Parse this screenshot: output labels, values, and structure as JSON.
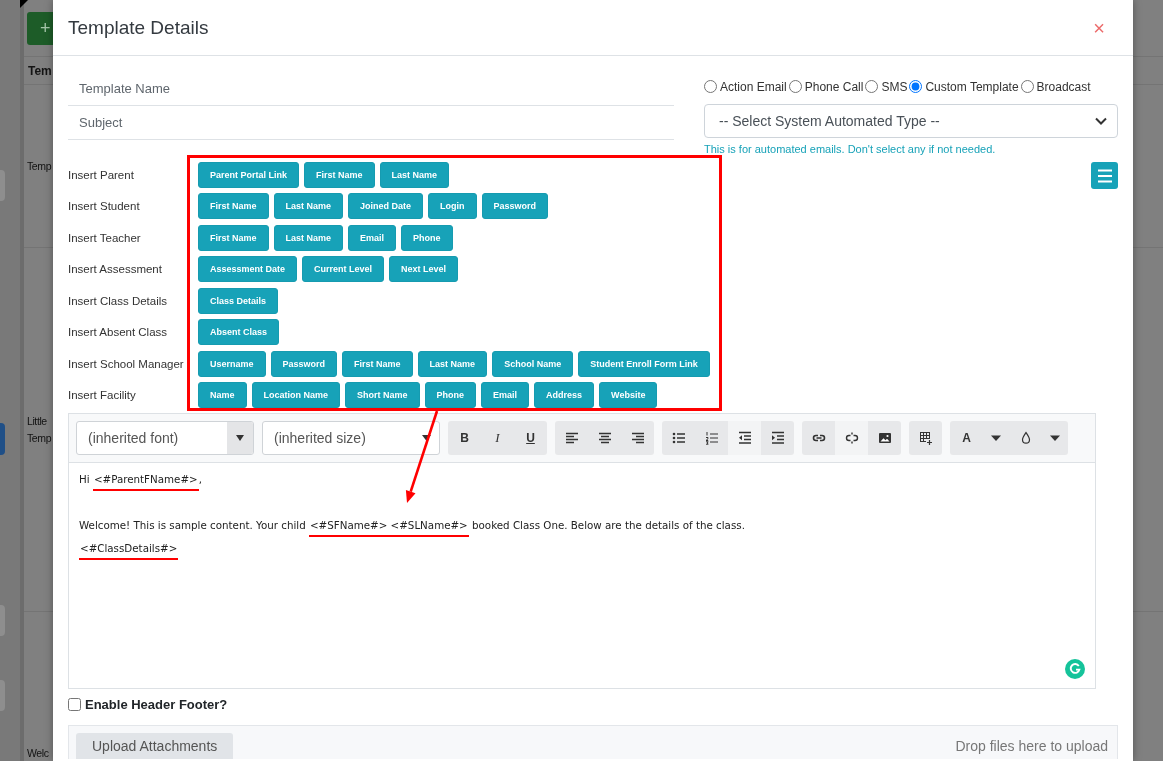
{
  "background_page": {
    "add_button": "+",
    "column_header": "Tem",
    "rows": [
      [
        "Temp"
      ],
      [
        "Little",
        "Temp"
      ],
      [
        "Welc"
      ]
    ],
    "side_buttons": [
      {
        "selected": false
      },
      {
        "selected": true
      },
      {
        "selected": false
      },
      {
        "selected": false
      }
    ]
  },
  "modal": {
    "title": "Template Details",
    "close": "×"
  },
  "form": {
    "template_name": {
      "placeholder": "Template Name"
    },
    "subject": {
      "placeholder": "Subject"
    },
    "template_types": [
      {
        "label": "Action Email",
        "selected": false
      },
      {
        "label": "Phone Call",
        "selected": false
      },
      {
        "label": "SMS",
        "selected": false
      },
      {
        "label": "Custom Template",
        "selected": true
      },
      {
        "label": "Broadcast",
        "selected": false
      }
    ],
    "system_type": {
      "value": "-- Select System Automated Type --"
    },
    "help_text": "This is for automated emails. Don't select any if not needed."
  },
  "insert_groups": [
    {
      "label": "Insert Parent",
      "buttons": [
        "Parent Portal Link",
        "First Name",
        "Last Name"
      ]
    },
    {
      "label": "Insert Student",
      "buttons": [
        "First Name",
        "Last Name",
        "Joined Date",
        "Login",
        "Password"
      ]
    },
    {
      "label": "Insert Teacher",
      "buttons": [
        "First Name",
        "Last Name",
        "Email",
        "Phone"
      ]
    },
    {
      "label": "Insert Assessment",
      "buttons": [
        "Assessment Date",
        "Current Level",
        "Next Level"
      ]
    },
    {
      "label": "Insert Class Details",
      "buttons": [
        "Class Details"
      ]
    },
    {
      "label": "Insert Absent Class",
      "buttons": [
        "Absent Class"
      ]
    },
    {
      "label": "Insert School Manager",
      "buttons": [
        "Username",
        "Password",
        "First Name",
        "Last Name",
        "School Name",
        "Student Enroll Form Link"
      ]
    },
    {
      "label": "Insert Facility",
      "buttons": [
        "Name",
        "Location Name",
        "Short Name",
        "Phone",
        "Email",
        "Address",
        "Website"
      ]
    }
  ],
  "editor": {
    "font": "(inherited font)",
    "size": "(inherited size)",
    "toolbar_groups": [
      {
        "buttons": [
          {
            "kind": "bold",
            "label": "B",
            "disabled": false
          },
          {
            "kind": "italic",
            "label": "I",
            "disabled": false
          },
          {
            "kind": "underline",
            "label": "U",
            "disabled": false
          }
        ]
      },
      {
        "buttons": [
          {
            "kind": "align-left",
            "disabled": false
          },
          {
            "kind": "align-center",
            "disabled": false
          },
          {
            "kind": "align-right",
            "disabled": false
          }
        ]
      },
      {
        "buttons": [
          {
            "kind": "bullet-list",
            "disabled": false
          },
          {
            "kind": "numbered-list",
            "disabled": false
          },
          {
            "kind": "outdent",
            "disabled": true
          },
          {
            "kind": "indent",
            "disabled": false
          }
        ]
      },
      {
        "buttons": [
          {
            "kind": "link",
            "disabled": false
          },
          {
            "kind": "unlink",
            "disabled": true
          },
          {
            "kind": "image",
            "disabled": false
          }
        ]
      },
      {
        "buttons": [
          {
            "kind": "table",
            "disabled": false
          }
        ]
      },
      {
        "buttons": [
          {
            "kind": "text-color",
            "label": "A",
            "disabled": false
          },
          {
            "kind": "dropdown",
            "disabled": false
          },
          {
            "kind": "fill-color",
            "disabled": false
          },
          {
            "kind": "dropdown",
            "disabled": false
          }
        ]
      }
    ],
    "paragraphs": [
      {
        "kind": "text",
        "segments": [
          {
            "text": "Hi ",
            "highlighted": false
          },
          {
            "text": "<#ParentFName#>",
            "highlighted": true
          },
          {
            "text": ",",
            "highlighted": false
          }
        ]
      },
      {
        "kind": "empty-line"
      },
      {
        "kind": "text",
        "segments": [
          {
            "text": "Welcome! This is sample content. Your child ",
            "highlighted": false
          },
          {
            "text": "<#SFName#> <#SLName#>",
            "highlighted": true
          },
          {
            "text": " booked Class One. Below are the details of the class.",
            "highlighted": false
          }
        ]
      },
      {
        "kind": "text",
        "segments": [
          {
            "text": "<#ClassDetails#>",
            "highlighted": true
          }
        ]
      }
    ]
  },
  "header_footer": {
    "label": "Enable Header Footer?",
    "checked": false
  },
  "attachments": {
    "button": "Upload Attachments",
    "hint": "Drop files here to upload"
  }
}
